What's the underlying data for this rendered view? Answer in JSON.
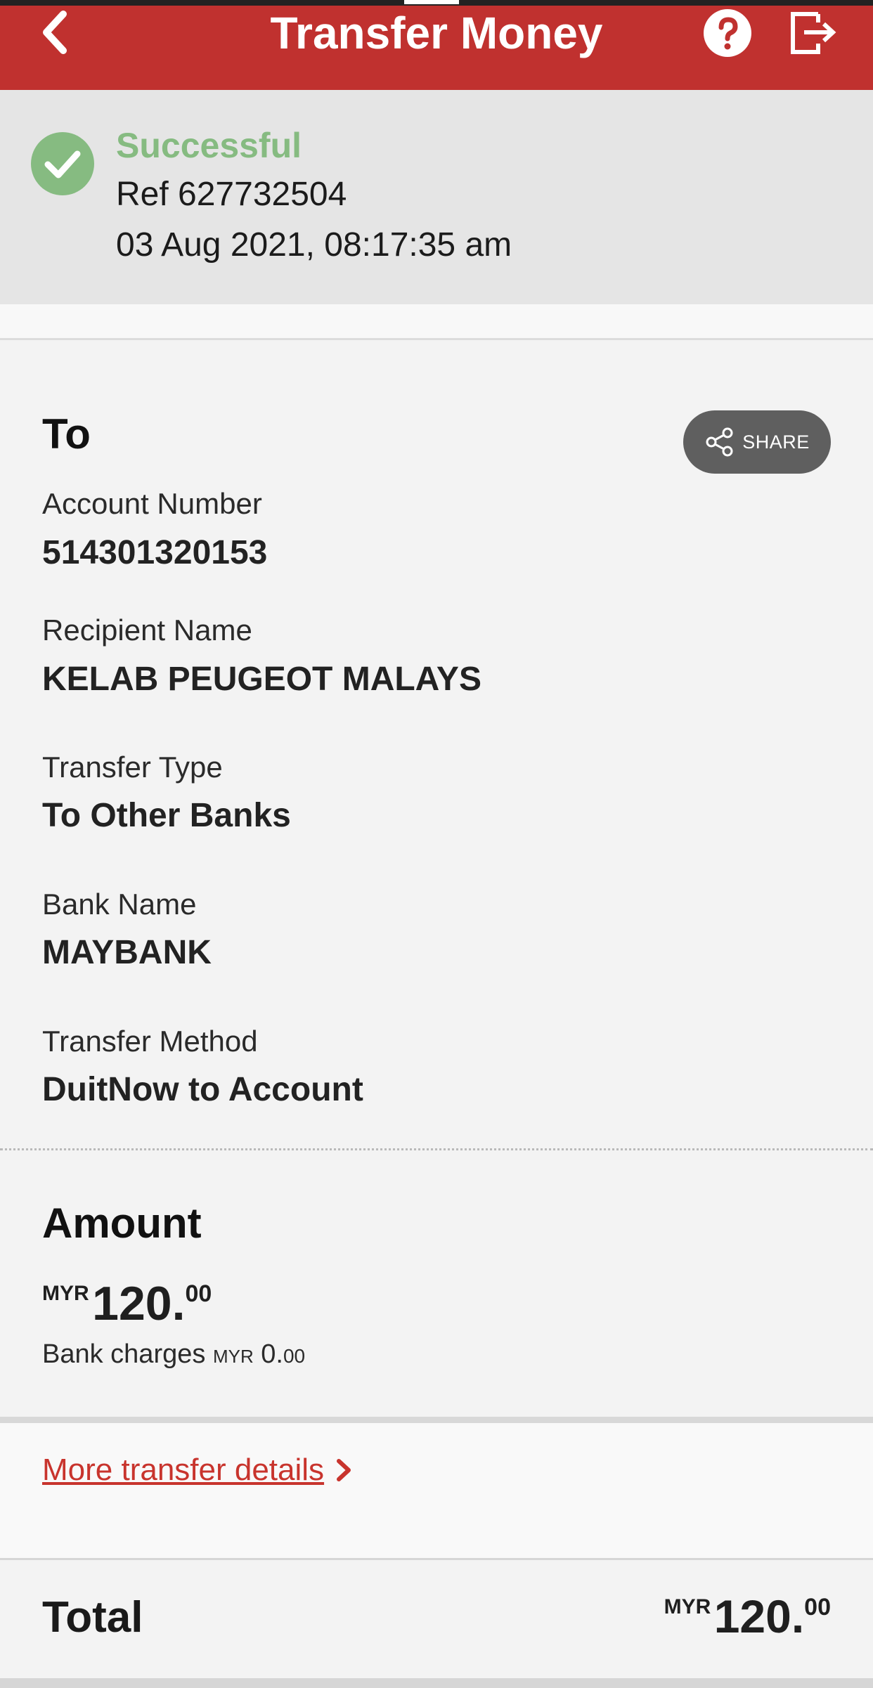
{
  "header": {
    "title": "Transfer Money",
    "back_icon": "chevron-left-icon",
    "help_icon": "help-icon",
    "logout_icon": "logout-icon",
    "brand_color": "#c0312f"
  },
  "status": {
    "state": "Successful",
    "reference": "Ref 627732504",
    "datetime": "03 Aug 2021, 08:17:35 am",
    "icon": "check-circle-icon",
    "success_color": "#86bb81"
  },
  "recipient": {
    "section_title": "To",
    "share_label": "SHARE",
    "share_icon": "share-icon",
    "fields": [
      {
        "label": "Account Number",
        "value": "514301320153"
      },
      {
        "label": "Recipient Name",
        "value": "KELAB PEUGEOT MALAYS"
      },
      {
        "label": "Transfer Type",
        "value": "To Other Banks"
      },
      {
        "label": "Bank Name",
        "value": "MAYBANK"
      },
      {
        "label": "Transfer Method",
        "value": "DuitNow to Account"
      }
    ]
  },
  "amount": {
    "section_title": "Amount",
    "currency": "MYR",
    "integer": "120.",
    "decimal": "00",
    "charges_label": "Bank charges",
    "charges_currency": "MYR",
    "charges_integer": "0.",
    "charges_decimal": "00"
  },
  "more_details": {
    "label": "More transfer details",
    "icon": "chevron-right-icon",
    "link_color": "#c8342d"
  },
  "total": {
    "label": "Total",
    "currency": "MYR",
    "integer": "120.",
    "decimal": "00"
  }
}
